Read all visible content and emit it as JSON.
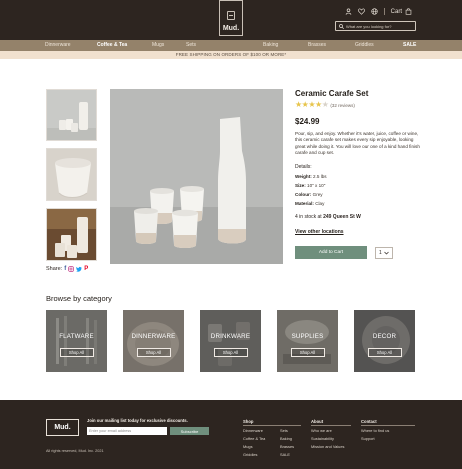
{
  "header": {
    "logo": "Mud.",
    "cart_label": "Cart",
    "search_placeholder": "What are you looking for?"
  },
  "nav": {
    "items": [
      {
        "label": "Dinnerware"
      },
      {
        "label": "Coffee & Tea"
      },
      {
        "label": "Mugs"
      },
      {
        "label": "Sets"
      },
      {
        "label": "Baking"
      },
      {
        "label": "Brasses"
      },
      {
        "label": "Griddles"
      },
      {
        "label": "SALE"
      }
    ],
    "active": "Coffee & Tea"
  },
  "promo": "FREE SHIPPING ON ORDERS OF $100 OR MORE*",
  "product": {
    "title": "Ceramic Carafe Set",
    "rating": 4,
    "rating_max": 5,
    "reviews": "(32 reviews)",
    "price": "$24.99",
    "description": "Pour, sip, and enjoy. Whether it's water, juice, coffee or wine, this ceramic carafe set makes every sip enjoyable, looking great while doing it. You will love our one of a kind hand finish carafe and cup set.",
    "details_heading": "Details:",
    "details": [
      {
        "label": "Weight:",
        "value": "2.5 lbs"
      },
      {
        "label": "Size:",
        "value": "10\" x 10\""
      },
      {
        "label": "Colour:",
        "value": "Grey"
      },
      {
        "label": "Material:",
        "value": "Clay"
      }
    ],
    "stock_prefix": "4 in stock at",
    "stock_location": "249 Queen St W",
    "view_locations": "View other locations",
    "add_to_cart": "Add to Cart",
    "quantity": "1",
    "share_label": "Share:"
  },
  "categories": {
    "heading": "Browse by category",
    "items": [
      {
        "title": "FLATWARE",
        "button": "Shop All"
      },
      {
        "title": "DINNERWARE",
        "button": "Shop All"
      },
      {
        "title": "DRINKWARE",
        "button": "Shop All"
      },
      {
        "title": "SUPPLIES",
        "button": "Shop All"
      },
      {
        "title": "DECOR",
        "button": "Shop All"
      }
    ]
  },
  "footer": {
    "logo": "Mud.",
    "mailing_label": "Join our mailing list today for exclusive discounts.",
    "email_placeholder": "Enter your email address",
    "subscribe": "Subscribe",
    "rights": "All rights reserved, Mud. Inc. 2021",
    "columns": [
      {
        "heading": "Shop",
        "links": [
          "Dinnerware",
          "Coffee & Tea",
          "Mugs",
          "Griddles"
        ]
      },
      {
        "heading": "",
        "links": [
          "Sets",
          "Baking",
          "Brasses",
          "SALE"
        ]
      },
      {
        "heading": "About",
        "links": [
          "Who we are",
          "Sustainability",
          "Mission and Values"
        ]
      },
      {
        "heading": "Contact",
        "links": [
          "Where to find us",
          "Support"
        ]
      }
    ]
  },
  "colors": {
    "header_bg": "#2d2520",
    "nav_bg": "#94826a",
    "promo_bg": "#f1e1cf",
    "accent_green": "#6f8f7d",
    "star": "#e7c44a"
  }
}
